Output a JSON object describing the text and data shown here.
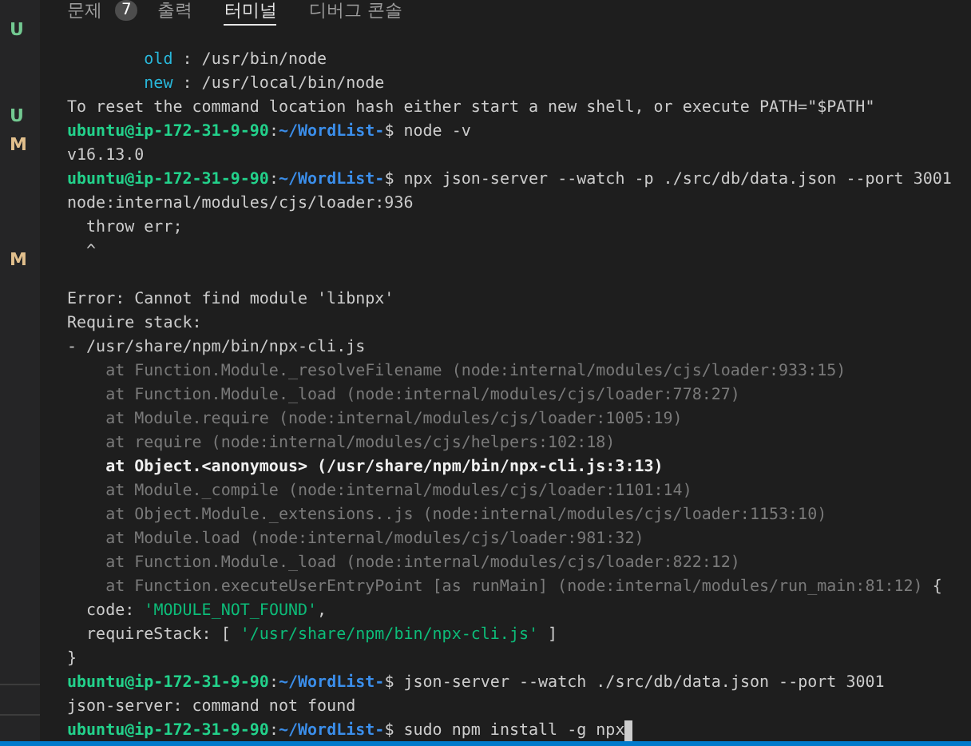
{
  "panel_tabs": [
    {
      "label": "문제",
      "badge": "7",
      "selected": false
    },
    {
      "label": "출력",
      "selected": false
    },
    {
      "label": "터미널",
      "selected": true
    },
    {
      "label": "디버그 콘솔",
      "selected": false
    }
  ],
  "gutter": [
    {
      "kind": "status",
      "text": "U",
      "color": "#73c991"
    },
    {
      "kind": "empty"
    },
    {
      "kind": "empty"
    },
    {
      "kind": "status",
      "text": "U",
      "color": "#73c991"
    },
    {
      "kind": "status",
      "text": "M",
      "color": "#e2c08d"
    },
    {
      "kind": "empty"
    },
    {
      "kind": "empty"
    },
    {
      "kind": "empty"
    },
    {
      "kind": "status",
      "text": "M",
      "color": "#e2c08d"
    }
  ],
  "terminal": {
    "lines": [
      {
        "kind": "text",
        "segments": [
          {
            "kind": "key",
            "text": "        old"
          },
          {
            "kind": "plain",
            "text": " : /usr/bin/node"
          }
        ]
      },
      {
        "kind": "text",
        "segments": [
          {
            "kind": "key",
            "text": "        new"
          },
          {
            "kind": "plain",
            "text": " : /usr/local/bin/node"
          }
        ]
      },
      {
        "kind": "text",
        "segments": [
          {
            "kind": "plain",
            "text": "To reset the command location hash either start a new shell, or execute PATH=\"$PATH\""
          }
        ]
      },
      {
        "kind": "text",
        "segments": [
          {
            "kind": "user",
            "text": "ubuntu@ip-172-31-9-90"
          },
          {
            "kind": "plain",
            "text": ":"
          },
          {
            "kind": "path",
            "text": "~/WordList-"
          },
          {
            "kind": "plain",
            "text": "$ node -v"
          }
        ]
      },
      {
        "kind": "text",
        "segments": [
          {
            "kind": "plain",
            "text": "v16.13.0"
          }
        ]
      },
      {
        "kind": "text",
        "segments": [
          {
            "kind": "user",
            "text": "ubuntu@ip-172-31-9-90"
          },
          {
            "kind": "plain",
            "text": ":"
          },
          {
            "kind": "path",
            "text": "~/WordList-"
          },
          {
            "kind": "plain",
            "text": "$ npx json-server --watch -p ./src/db/data.json --port 3001"
          }
        ]
      },
      {
        "kind": "text",
        "segments": [
          {
            "kind": "plain",
            "text": "node:internal/modules/cjs/loader:936"
          }
        ]
      },
      {
        "kind": "text",
        "segments": [
          {
            "kind": "plain",
            "text": "  throw err;"
          }
        ]
      },
      {
        "kind": "text",
        "segments": [
          {
            "kind": "plain",
            "text": "  ^"
          }
        ]
      },
      {
        "kind": "blank"
      },
      {
        "kind": "text",
        "segments": [
          {
            "kind": "plain",
            "text": "Error: Cannot find module 'libnpx'"
          }
        ]
      },
      {
        "kind": "text",
        "segments": [
          {
            "kind": "plain",
            "text": "Require stack:"
          }
        ]
      },
      {
        "kind": "text",
        "segments": [
          {
            "kind": "plain",
            "text": "- /usr/share/npm/bin/npx-cli.js"
          }
        ]
      },
      {
        "kind": "text",
        "segments": [
          {
            "kind": "dim",
            "text": "    at Function.Module._resolveFilename (node:internal/modules/cjs/loader:933:15)"
          }
        ]
      },
      {
        "kind": "text",
        "segments": [
          {
            "kind": "dim",
            "text": "    at Function.Module._load (node:internal/modules/cjs/loader:778:27)"
          }
        ]
      },
      {
        "kind": "text",
        "segments": [
          {
            "kind": "dim",
            "text": "    at Module.require (node:internal/modules/cjs/loader:1005:19)"
          }
        ]
      },
      {
        "kind": "text",
        "segments": [
          {
            "kind": "dim",
            "text": "    at require (node:internal/modules/cjs/helpers:102:18)"
          }
        ]
      },
      {
        "kind": "text",
        "segments": [
          {
            "kind": "bright",
            "text": "    at Object.<anonymous> (/usr/share/npm/bin/npx-cli.js:3:13)"
          }
        ]
      },
      {
        "kind": "text",
        "segments": [
          {
            "kind": "dim",
            "text": "    at Module._compile (node:internal/modules/cjs/loader:1101:14)"
          }
        ]
      },
      {
        "kind": "text",
        "segments": [
          {
            "kind": "dim",
            "text": "    at Object.Module._extensions..js (node:internal/modules/cjs/loader:1153:10)"
          }
        ]
      },
      {
        "kind": "text",
        "segments": [
          {
            "kind": "dim",
            "text": "    at Module.load (node:internal/modules/cjs/loader:981:32)"
          }
        ]
      },
      {
        "kind": "text",
        "segments": [
          {
            "kind": "dim",
            "text": "    at Function.Module._load (node:internal/modules/cjs/loader:822:12)"
          }
        ]
      },
      {
        "kind": "text",
        "segments": [
          {
            "kind": "dim",
            "text": "    at Function.executeUserEntryPoint [as runMain] (node:internal/modules/run_main:81:12)"
          },
          {
            "kind": "plain",
            "text": " {"
          }
        ]
      },
      {
        "kind": "text",
        "segments": [
          {
            "kind": "plain",
            "text": "  code: "
          },
          {
            "kind": "string",
            "text": "'MODULE_NOT_FOUND'"
          },
          {
            "kind": "plain",
            "text": ","
          }
        ]
      },
      {
        "kind": "text",
        "segments": [
          {
            "kind": "plain",
            "text": "  requireStack: [ "
          },
          {
            "kind": "string",
            "text": "'/usr/share/npm/bin/npx-cli.js'"
          },
          {
            "kind": "plain",
            "text": " ]"
          }
        ]
      },
      {
        "kind": "text",
        "segments": [
          {
            "kind": "plain",
            "text": "}"
          }
        ]
      },
      {
        "kind": "text",
        "segments": [
          {
            "kind": "user",
            "text": "ubuntu@ip-172-31-9-90"
          },
          {
            "kind": "plain",
            "text": ":"
          },
          {
            "kind": "path",
            "text": "~/WordList-"
          },
          {
            "kind": "plain",
            "text": "$ json-server --watch ./src/db/data.json --port 3001"
          }
        ]
      },
      {
        "kind": "text",
        "segments": [
          {
            "kind": "plain",
            "text": "json-server: command not found"
          }
        ]
      },
      {
        "kind": "text",
        "cursor": true,
        "segments": [
          {
            "kind": "user",
            "text": "ubuntu@ip-172-31-9-90"
          },
          {
            "kind": "plain",
            "text": ":"
          },
          {
            "kind": "path",
            "text": "~/WordList-"
          },
          {
            "kind": "plain",
            "text": "$ sudo npm install -g npx"
          }
        ]
      }
    ]
  }
}
